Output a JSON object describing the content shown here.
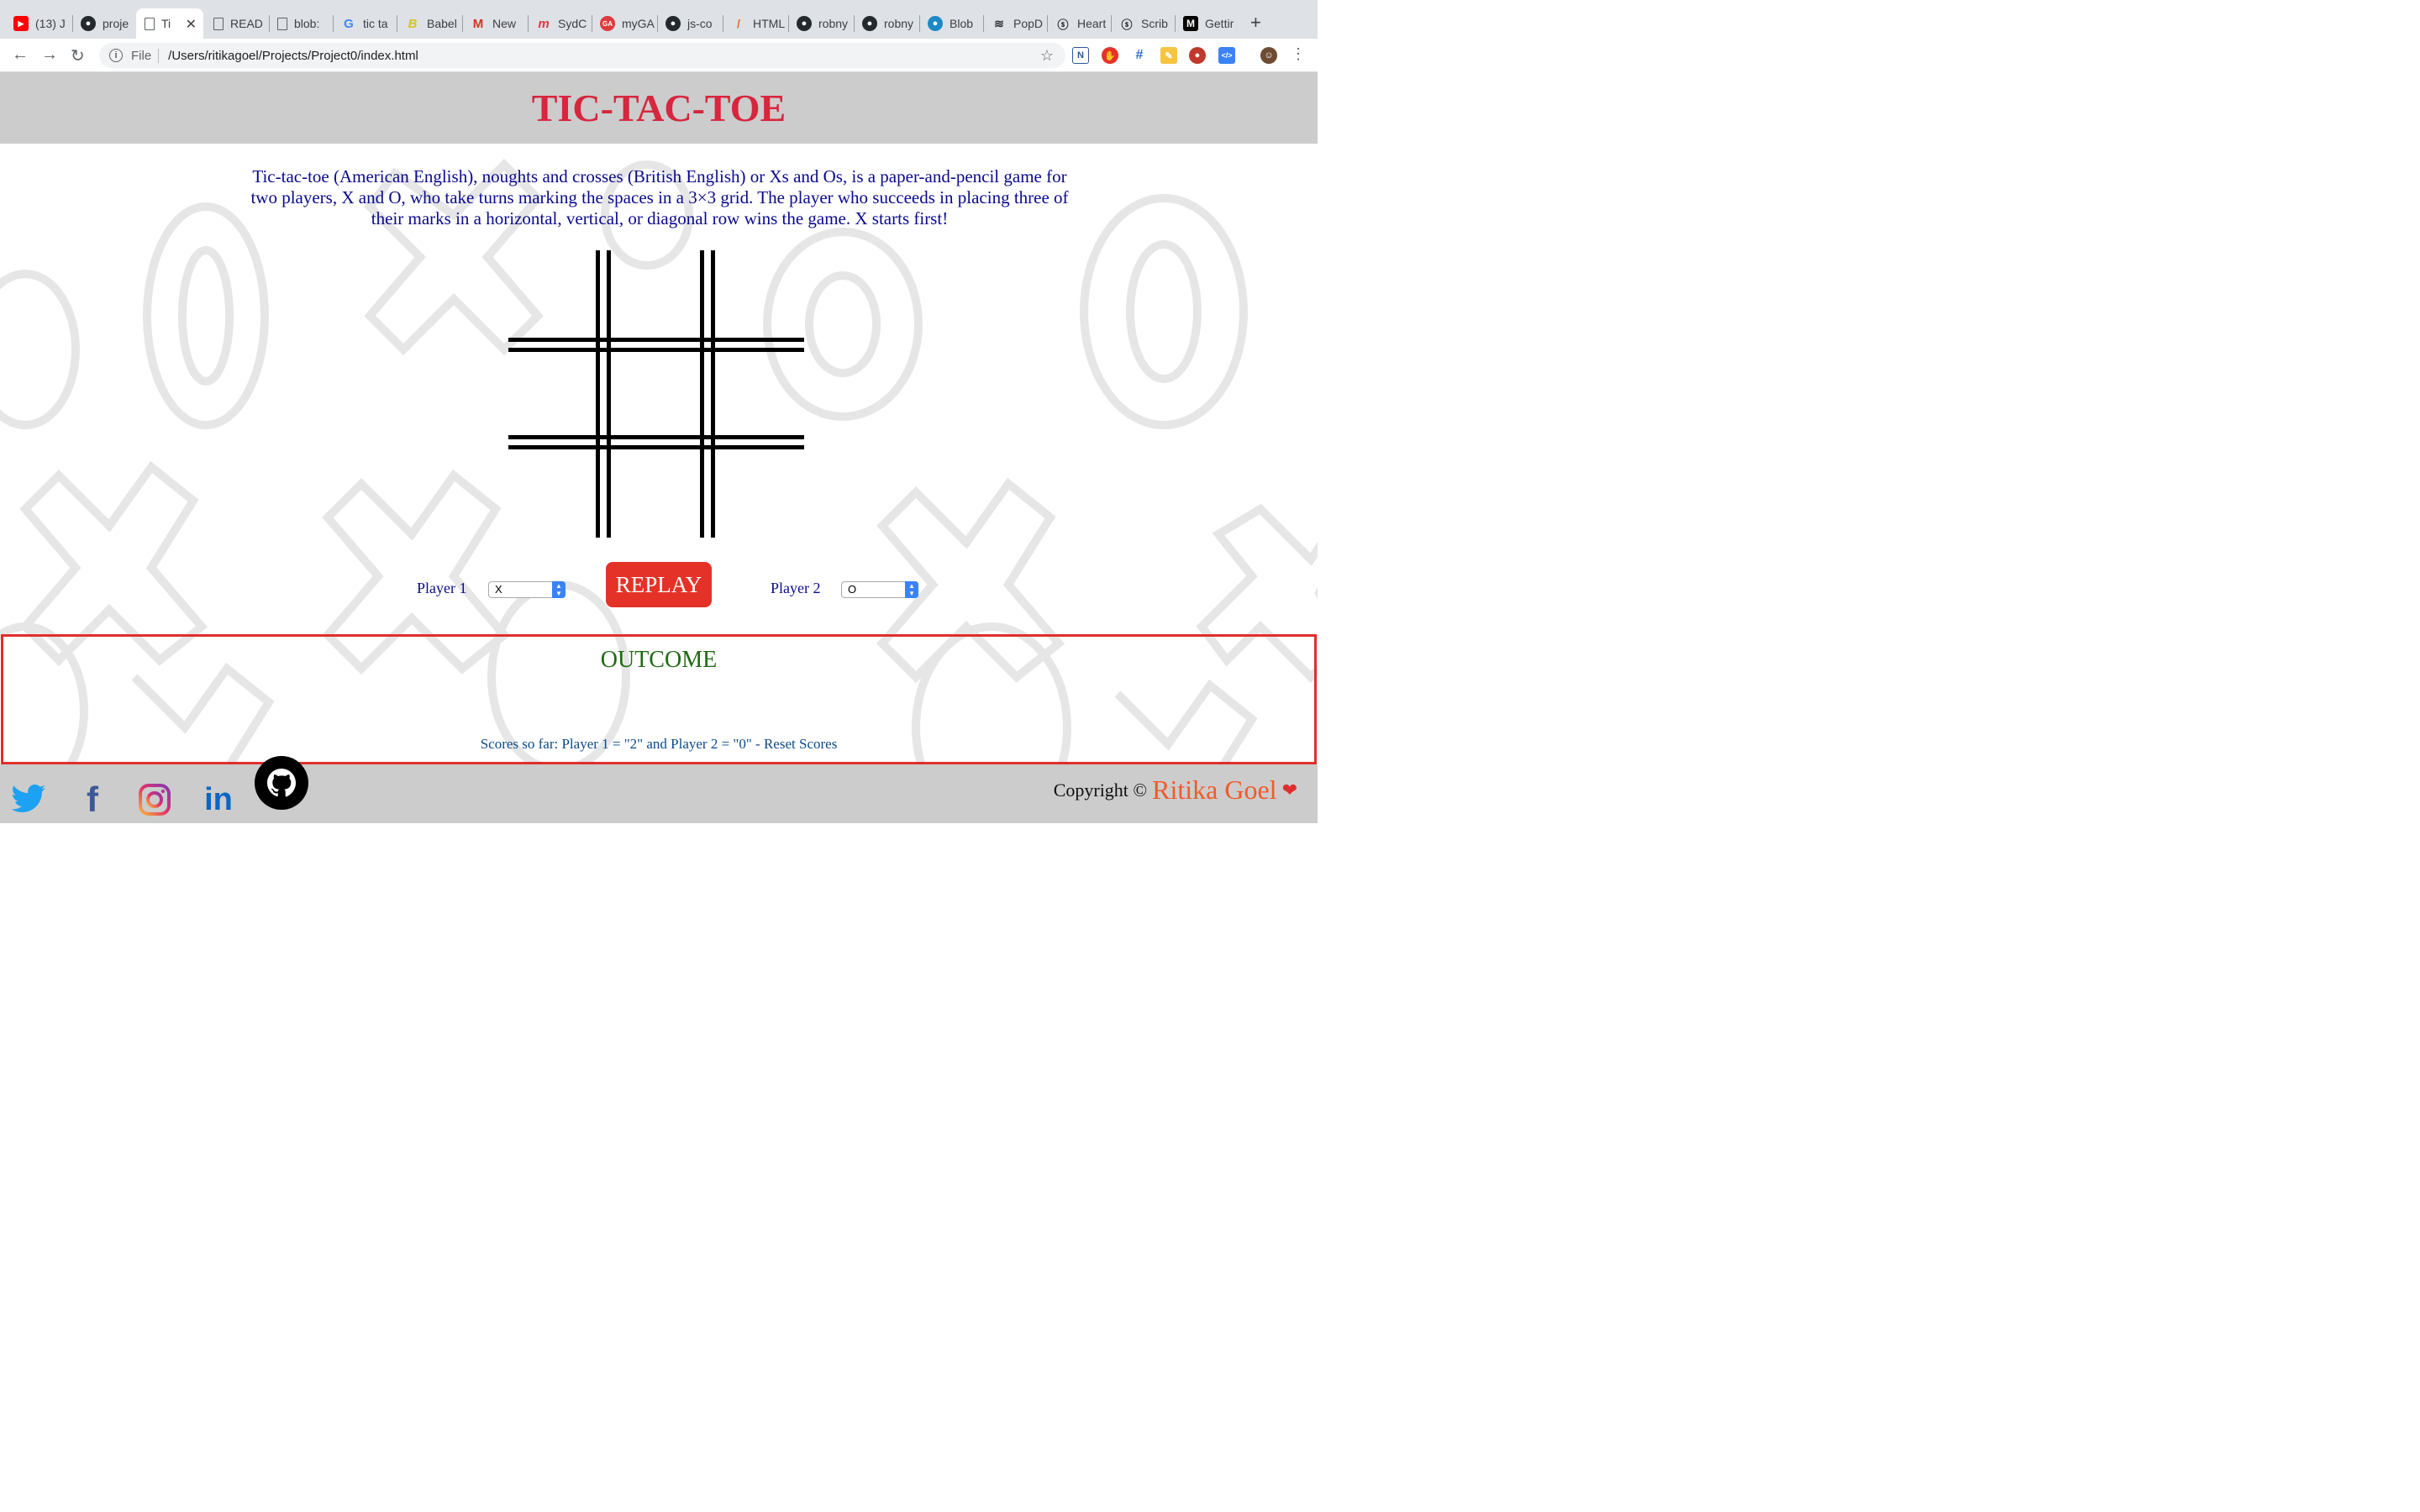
{
  "browser": {
    "tabs": [
      {
        "label": "(13) J",
        "icon": "youtube-icon"
      },
      {
        "label": "proje",
        "icon": "github-icon"
      },
      {
        "label": "Ti",
        "icon": "page-icon",
        "active": true
      },
      {
        "label": "READ",
        "icon": "page-icon"
      },
      {
        "label": "blob:",
        "icon": "page-icon"
      },
      {
        "label": "tic ta",
        "icon": "google-icon"
      },
      {
        "label": "Babel",
        "icon": "babel-icon"
      },
      {
        "label": "New",
        "icon": "gmail-icon"
      },
      {
        "label": "SydC",
        "icon": "meetup-icon"
      },
      {
        "label": "myGA",
        "icon": "ga-icon"
      },
      {
        "label": "js-co",
        "icon": "github-icon"
      },
      {
        "label": "HTML",
        "icon": "html-icon"
      },
      {
        "label": "robny",
        "icon": "github-icon"
      },
      {
        "label": "robny",
        "icon": "github-icon"
      },
      {
        "label": "Blob",
        "icon": "blob-icon"
      },
      {
        "label": "PopD",
        "icon": "popd-icon"
      },
      {
        "label": "Heart",
        "icon": "scribd-icon"
      },
      {
        "label": "Scrib",
        "icon": "scribd-icon"
      },
      {
        "label": "Gettir",
        "icon": "medium-icon"
      }
    ],
    "scheme": "File",
    "url": "/Users/ritikagoel/Projects/Project0/index.html"
  },
  "page": {
    "title": "TIC-TAC-TOE",
    "description": "Tic-tac-toe (American English), noughts and crosses (British English) or Xs and Os, is a paper-and-pencil game for two players, X and O, who take turns marking the spaces in a 3×3 grid. The player who succeeds in placing three of their marks in a horizontal, vertical, or diagonal row wins the game. X starts first!",
    "player1_label": "Player 1",
    "player1_value": "X",
    "player2_label": "Player 2",
    "player2_value": "O",
    "replay_label": "REPLAY",
    "outcome_title": "OUTCOME",
    "scores_text": "Scores so far: Player 1 = \"2\" and Player 2 = \"0\" - Reset Scores",
    "copyright_label": "Copyright ©",
    "author": "Ritika Goel"
  },
  "colors": {
    "title": "#d7263d",
    "text": "#0a0a8c",
    "replay": "#e53228",
    "outcome_border": "#e02e2e",
    "outcome_title": "#1f6b12"
  }
}
